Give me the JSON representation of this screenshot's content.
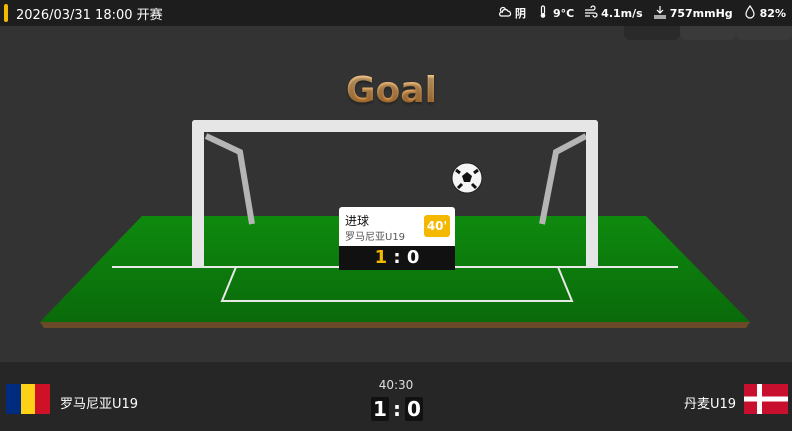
{
  "header": {
    "datetime": "2026/03/31 18:00 开赛",
    "weather": [
      {
        "icon": "cloudy-icon",
        "value": "阴"
      },
      {
        "icon": "thermometer-icon",
        "value": "9°C"
      },
      {
        "icon": "wind-icon",
        "value": "4.1m/s"
      },
      {
        "icon": "pressure-icon",
        "value": "757mmHg"
      },
      {
        "icon": "humidity-icon",
        "value": "82%"
      }
    ]
  },
  "animation": {
    "event_title": "Goal",
    "event_card": {
      "type": "进球",
      "team": "罗马尼亚U19",
      "minute": "40'",
      "home_score": "1",
      "separator": ":",
      "away_score": "0"
    }
  },
  "match": {
    "home_team": "罗马尼亚U19",
    "away_team": "丹麦U19",
    "clock": "40:30",
    "home_score": "1",
    "separator": ":",
    "away_score": "0"
  },
  "colors": {
    "accent": "#f5b800",
    "pitch": "#0c7a0c"
  }
}
